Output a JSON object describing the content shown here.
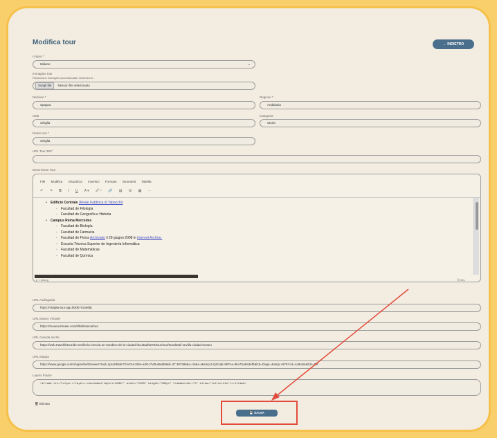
{
  "page_title": "Modifica tour",
  "back_button": "← INDIETRO",
  "lingua": {
    "label": "Lingua *",
    "value": "Italiano"
  },
  "immagine": {
    "label": "Immagine tour",
    "hint": "Risoluzione immagini raccomandata: dimensione...",
    "button": "Scegli file",
    "status": "Nessun file selezionato"
  },
  "nazione": {
    "label": "Nazione *",
    "value": "Spagna"
  },
  "regione": {
    "label": "Regione *",
    "value": "Andalusia"
  },
  "citta": {
    "label": "Città",
    "value": "Siviglia"
  },
  "categoria": {
    "label": "Categoria",
    "value": "Storia"
  },
  "nome_tour": {
    "label": "Nome tour *",
    "value": "Siviglia"
  },
  "url_tour_360": {
    "label": "URL Tour 360°",
    "value": ""
  },
  "descrizione": {
    "label": "Descrizione Tour",
    "menu": [
      "File",
      "Modifica",
      "Visualizza",
      "Inserisci",
      "Formato",
      "Strumenti",
      "Tabella"
    ],
    "toolbar": [
      "↶",
      "↷",
      "B",
      "I",
      "U",
      "A ▾",
      "🖉 ▾",
      "🔗",
      "▤",
      "☰",
      "▦",
      "⋯"
    ],
    "lines": [
      {
        "level": 1,
        "bold": "Edificio Centrale",
        "link": "(Reale Fabbrica di Tabacchi)"
      },
      {
        "level": 2,
        "text": "Facultad de Filología"
      },
      {
        "level": 2,
        "text": "Facultad de Geografía e Historia"
      },
      {
        "level": 1,
        "bold": "Campus Reina Mercedes"
      },
      {
        "level": 2,
        "text": "Facultad de Biología"
      },
      {
        "level": 2,
        "text": "Facultad de Farmacia"
      },
      {
        "level": 2,
        "text": "Facultad de Física",
        "link": "Archiviato",
        "after": "il 29 giugno 2008 in",
        "link2": "Internet Archive."
      },
      {
        "level": 2,
        "text": "Escuela Técnica Superior de Ingeniería Informática"
      },
      {
        "level": 2,
        "text": "Facultad de Matemáticas"
      },
      {
        "level": 2,
        "text": "Facultad de Química"
      }
    ],
    "statusbar_left": "p » strong",
    "statusbar_right": "⓪ tiny"
  },
  "url_audioguida": {
    "label": "URL Audioguida",
    "value": "https://siviglia-tour.app.link/k7n2x9d8j"
  },
  "url_museo_virtuale": {
    "label": "URL Museo Virtuale",
    "value": "https://museovirtuale.com/it/biblioteca/tour"
  },
  "url_guarda_anche": {
    "label": "URL Guarda anche",
    "value": "https://web.travel/it/tour/de-sevilla-la-ciencia-un-sendero-de-la-ciudad-facultad/5276/tour/tour/tourdetail-sevilla-ciudad-museo"
  },
  "url_mappa": {
    "label": "URL Mappa",
    "value": "https://www.google.com/maps/d/u/0/viewer?mid=1p1sbb5lmT2-kCt4-Stbn-a3Gc7vt0uNa5b9&ll=37.387286&z=15&r=t&amp;3-Q3c4jK-9hFAu-8kx7Sa5sdef0&lt;8=Dsg4=&amp;+8767-id=Ac9U64&lt;8=Z6f"
  },
  "layers_frame": {
    "label": "Layers Frame",
    "value": "<iframe src=\"https://layers.com/embed/layers/4839/\" width=\"100%\" height=\"300px\" frameborder=\"0\" allow=\"fullscreen\"></iframe>"
  },
  "elimina": "🗑 Elimina",
  "save_button": "💾 SALVA"
}
